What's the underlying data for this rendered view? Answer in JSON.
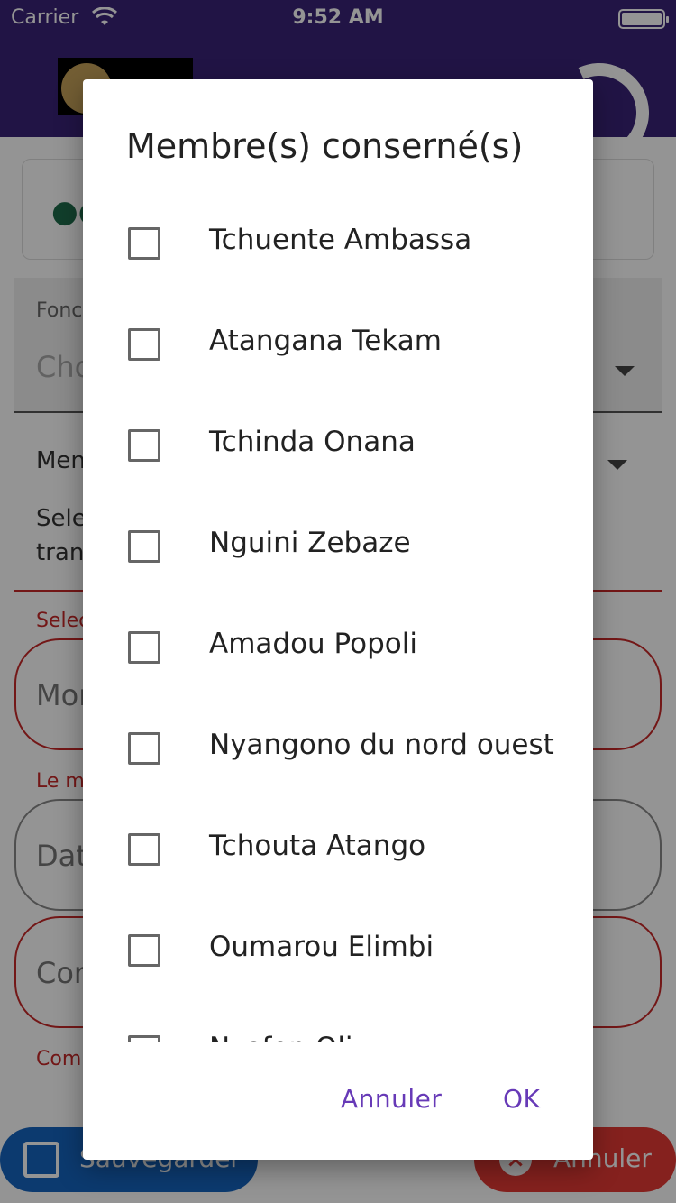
{
  "status_bar": {
    "carrier": "Carrier",
    "time": "9:52 AM"
  },
  "background": {
    "form_fields_partial": [
      "Fonc",
      "Cho",
      "Men",
      "Sele",
      "tran",
      "Selec",
      "Mon",
      "Le m",
      "Dat",
      "Con",
      "Com"
    ],
    "save_label": "Sauvegarder",
    "cancel_label": "Annuler"
  },
  "dialog": {
    "title": "Membre(s) conserné(s)",
    "members": [
      {
        "name": "Tchuente Ambassa",
        "checked": false
      },
      {
        "name": "Atangana Tekam",
        "checked": false
      },
      {
        "name": "Tchinda Onana",
        "checked": false
      },
      {
        "name": "Nguini Zebaze",
        "checked": false
      },
      {
        "name": "Amadou Popoli",
        "checked": false
      },
      {
        "name": "Nyangono du nord ouest",
        "checked": false
      },
      {
        "name": "Tchouta Atango",
        "checked": false
      },
      {
        "name": "Oumarou Elimbi",
        "checked": false
      },
      {
        "name": "Nzefon Oli",
        "checked": false
      }
    ],
    "cancel_label": "Annuler",
    "ok_label": "OK"
  },
  "colors": {
    "app_bar": "#3a2478",
    "accent": "#673ab7",
    "error": "#c62828"
  }
}
